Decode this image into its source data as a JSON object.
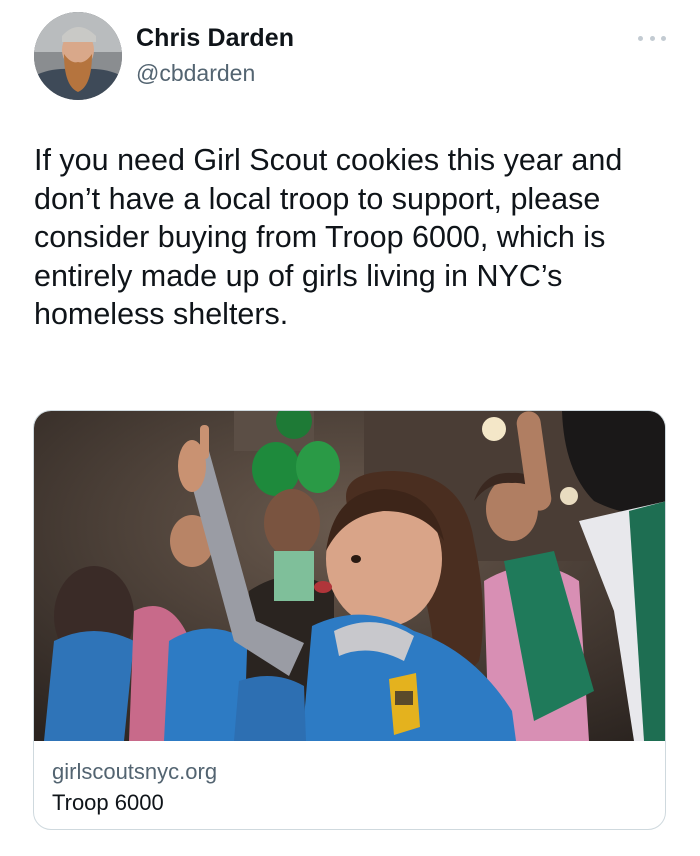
{
  "author": {
    "display_name": "Chris Darden",
    "handle": "@cbdarden",
    "avatar_icon": "profile-photo"
  },
  "more_icon": "more-horizontal-icon",
  "tweet": {
    "text": "If you need Girl Scout cookies this year and don’t have a local troop to support, please consider buying from Troop 6000, which is entirely made up of girls living in NYC’s homeless shelters."
  },
  "link_card": {
    "domain": "girlscoutsnyc.org",
    "title": "Troop 6000"
  },
  "colors": {
    "text_primary": "#0f1419",
    "text_secondary": "#536471",
    "border": "#cfd9de",
    "vest_blue": "#2d7bc4",
    "vest_green": "#1f7a5a",
    "balloon_green": "#1e8a3c"
  }
}
